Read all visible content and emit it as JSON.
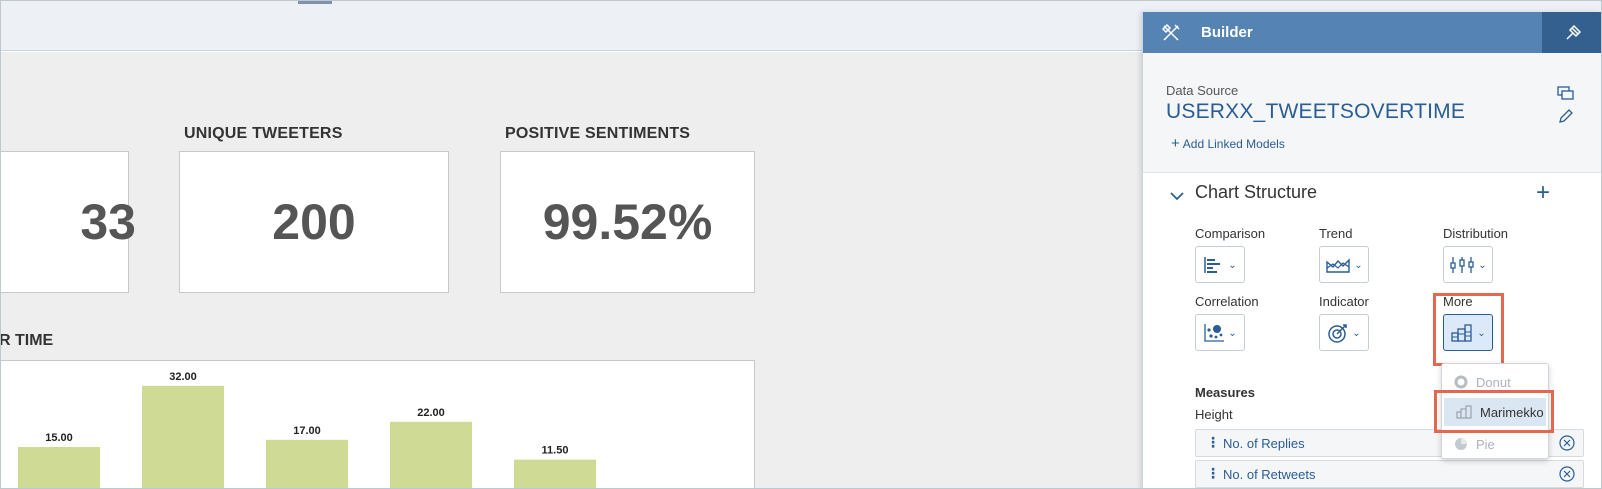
{
  "kpis": [
    {
      "title": "",
      "value": "33"
    },
    {
      "title": "UNIQUE TWEETERS",
      "value": "200"
    },
    {
      "title": "POSITIVE SENTIMENTS",
      "value": "99.52%"
    }
  ],
  "chart": {
    "title_fragment": "R TIME"
  },
  "chart_data": {
    "type": "bar",
    "categories": [
      "",
      "",
      "",
      "",
      ""
    ],
    "values": [
      15.0,
      32.0,
      17.0,
      22.0,
      11.5
    ],
    "data_labels": [
      "15.00",
      "32.00",
      "17.00",
      "22.00",
      "11.50"
    ],
    "inner_label": "32.00",
    "series": [
      {
        "values": [
          15.0,
          32.0,
          17.0,
          22.0,
          11.5
        ]
      }
    ],
    "colors": {
      "bar": "#cfdb95"
    }
  },
  "builder": {
    "title": "Builder",
    "data_source_label": "Data Source",
    "data_source_name": "USERXX_TWEETSOVERTIME",
    "add_linked_models": "Add Linked Models",
    "chart_structure": "Chart Structure",
    "chart_types": [
      {
        "label": "Comparison",
        "icon": "bar-horizontal-icon"
      },
      {
        "label": "Trend",
        "icon": "area-line-icon"
      },
      {
        "label": "Distribution",
        "icon": "box-plot-icon"
      },
      {
        "label": "Correlation",
        "icon": "scatter-icon"
      },
      {
        "label": "Indicator",
        "icon": "target-icon"
      },
      {
        "label": "More",
        "icon": "marimekko-icon"
      }
    ],
    "more_menu": [
      {
        "label": "Donut",
        "icon": "donut-icon",
        "enabled": false
      },
      {
        "label": "Marimekko",
        "icon": "marimekko-icon",
        "enabled": true,
        "selected": true
      },
      {
        "label": "Pie",
        "icon": "pie-icon",
        "enabled": false
      }
    ],
    "measures_label": "Measures",
    "height_label": "Height",
    "measures": [
      "No. of Replies",
      "No. of Retweets"
    ]
  },
  "colors": {
    "header_blue": "#5584b4",
    "header_dark": "#33608f",
    "link_blue": "#2a5d96",
    "highlight": "#e4674f"
  }
}
